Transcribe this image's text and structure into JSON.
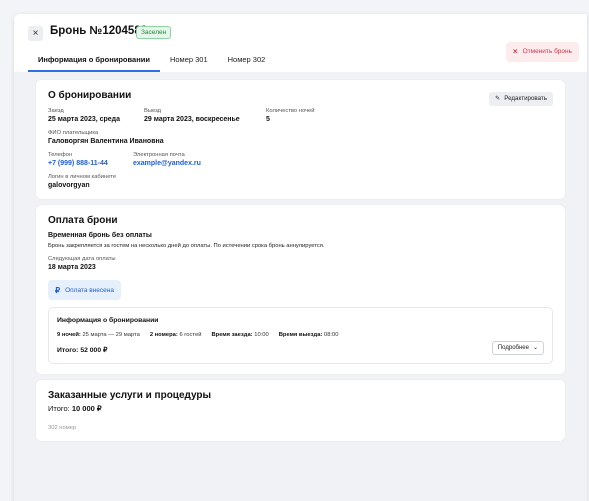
{
  "header": {
    "close_icon": "×",
    "title": "Бронь №1204583",
    "status_badge": "Заселен",
    "cancel_label": "Отменить бронь",
    "cancel_icon": "×"
  },
  "tabs": [
    {
      "label": "Информация о бронировании",
      "active": true
    },
    {
      "label": "Номер 301",
      "active": false
    },
    {
      "label": "Номер 302",
      "active": false
    }
  ],
  "booking": {
    "title": "О бронировании",
    "edit_label": "Редактировать",
    "checkin_label": "Заезд",
    "checkin_value": "25 марта 2023, среда",
    "checkout_label": "Выезд",
    "checkout_value": "29 марта 2023, воскресенье",
    "nights_label": "Количество ночей",
    "nights_value": "5",
    "payer_label": "ФИО плательщика",
    "payer_value": "Галоворгян Валентина Ивановна",
    "phone_label": "Телефон",
    "phone_value": "+7 (999) 888-11-44",
    "email_label": "Электронная почта",
    "email_value": "example@yandex.ru",
    "login_label": "Логин в личном кабинете",
    "login_value": "galovorgyan"
  },
  "payment": {
    "title": "Оплата брони",
    "subtitle": "Временная бронь без оплаты",
    "note": "Бронь закрепляется за гостем на несколько дней до оплаты. По истечении срока бронь аннулируется.",
    "next_date_label": "Следующая дата оплаты",
    "next_date_value": "18 марта 2023",
    "paid_icon": "₽",
    "paid_label": "Оплата внесена",
    "info": {
      "title": "Информация о бронировании",
      "nights_bold": "9 ночей:",
      "dates": "25 марта — 29 марта",
      "rooms_bold": "2 номера:",
      "guests": "6 гостей",
      "checkin_time_bold": "Время заезда:",
      "checkin_time": "10:00",
      "checkout_time_bold": "Время выезда:",
      "checkout_time": "08:00",
      "total": "Итого: 52 000 ₽",
      "more_label": "Подробнее",
      "more_icon": "⌄"
    }
  },
  "services": {
    "title": "Заказанные услуги и процедуры",
    "total_label": "Итого:",
    "total_value": "10 000 ₽",
    "faded_text": "302 номер"
  }
}
